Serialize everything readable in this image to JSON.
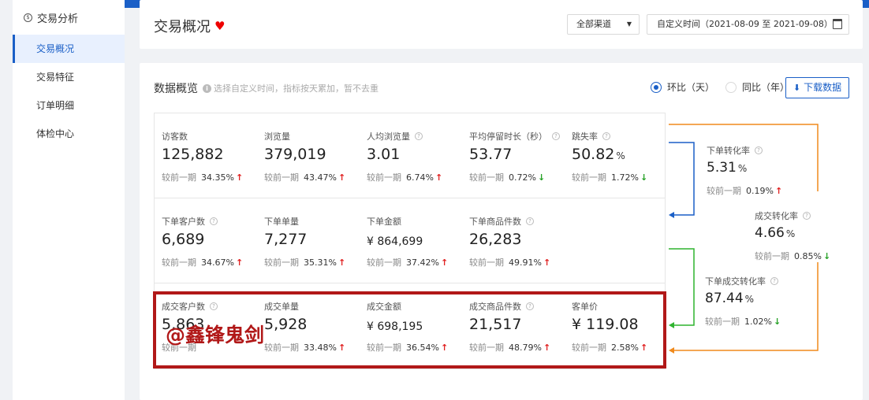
{
  "sidebar": {
    "group_icon": "currency-icon",
    "group_title": "交易分析",
    "items": [
      {
        "label": "交易概况",
        "active": true
      },
      {
        "label": "交易特征",
        "active": false
      },
      {
        "label": "订单明细",
        "active": false
      },
      {
        "label": "体检中心",
        "active": false
      }
    ]
  },
  "header": {
    "title": "交易概况",
    "heart_icon": "heart-icon",
    "channel_select": "全部渠道",
    "date_range": "自定义时间（2021-08-09 至 2021-09-08）",
    "calendar_icon": "calendar-icon"
  },
  "overview": {
    "title": "数据概览",
    "hint": "选择自定义时间，指标按天累加，暂不去重",
    "radio_day": "环比（天）",
    "radio_year": "同比（年）",
    "download_label": "下载数据",
    "cmp_label": "较前一期",
    "rows": [
      [
        {
          "label": "访客数",
          "value": "125,882",
          "unit": "",
          "pct": "34.35%",
          "dir": "up",
          "q": false
        },
        {
          "label": "浏览量",
          "value": "379,019",
          "unit": "",
          "pct": "43.47%",
          "dir": "up",
          "q": false
        },
        {
          "label": "人均浏览量",
          "value": "3.01",
          "unit": "",
          "pct": "6.74%",
          "dir": "up",
          "q": true
        },
        {
          "label": "平均停留时长（秒）",
          "value": "53.77",
          "unit": "",
          "pct": "0.72%",
          "dir": "down",
          "q": true
        },
        {
          "label": "跳失率",
          "value": "50.82",
          "unit": "%",
          "pct": "1.72%",
          "dir": "down",
          "q": true
        }
      ],
      [
        {
          "label": "下单客户数",
          "value": "6,689",
          "unit": "",
          "pct": "34.67%",
          "dir": "up",
          "q": true
        },
        {
          "label": "下单单量",
          "value": "7,277",
          "unit": "",
          "pct": "35.31%",
          "dir": "up",
          "q": false
        },
        {
          "label": "下单金额",
          "value": "¥ 864,699",
          "unit": "",
          "pct": "37.42%",
          "dir": "up",
          "q": false,
          "small": true
        },
        {
          "label": "下单商品件数",
          "value": "26,283",
          "unit": "",
          "pct": "49.91%",
          "dir": "up",
          "q": true
        }
      ],
      [
        {
          "label": "成交客户数",
          "value": "5,863",
          "unit": "",
          "pct": "",
          "dir": "",
          "q": true
        },
        {
          "label": "成交单量",
          "value": "5,928",
          "unit": "",
          "pct": "33.48%",
          "dir": "up",
          "q": false
        },
        {
          "label": "成交金额",
          "value": "¥ 698,195",
          "unit": "",
          "pct": "36.54%",
          "dir": "up",
          "q": false,
          "small": true
        },
        {
          "label": "成交商品件数",
          "value": "21,517",
          "unit": "",
          "pct": "48.79%",
          "dir": "up",
          "q": true
        },
        {
          "label": "客单价",
          "value": "¥ 119.08",
          "unit": "",
          "pct": "2.58%",
          "dir": "up",
          "q": false
        }
      ]
    ],
    "conversions": [
      {
        "label": "下单转化率",
        "value": "5.31",
        "unit": "%",
        "pct": "0.19%",
        "dir": "up"
      },
      {
        "label": "成交转化率",
        "value": "4.66",
        "unit": "%",
        "pct": "0.85%",
        "dir": "down"
      },
      {
        "label": "下单成交转化率",
        "value": "87.44",
        "unit": "%",
        "pct": "1.02%",
        "dir": "down"
      }
    ]
  },
  "watermark": "@鑫锋鬼剑",
  "colors": {
    "accent": "#1a5fc7",
    "up": "#e02020",
    "down": "#23a023",
    "flow_blue": "#1a5fc7",
    "flow_green": "#2fb32f",
    "flow_orange": "#f08a1c",
    "highlight": "#b11818"
  }
}
